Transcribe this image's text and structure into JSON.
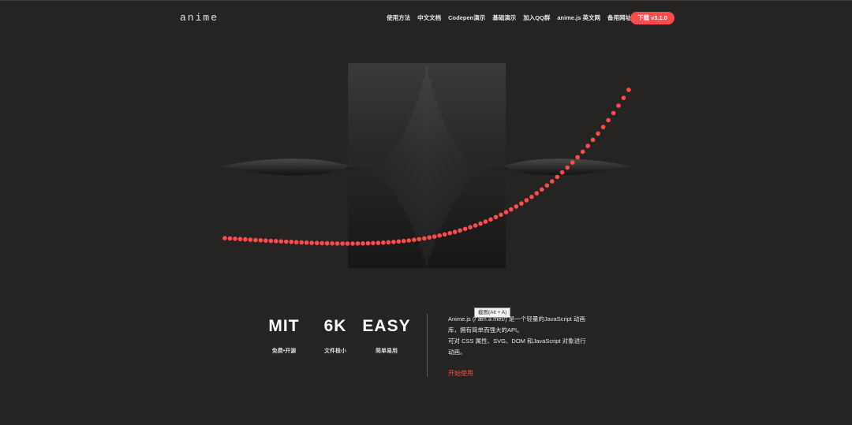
{
  "header": {
    "logo_text": "anime",
    "nav": [
      "使用方法",
      "中文文档",
      "Codepen演示",
      "基础演示",
      "加入QQ群",
      "anime.js 英文网",
      "备用网址"
    ],
    "download_label": "下载 v3.1.0"
  },
  "tooltip": "截图(Alt + A)",
  "stats": [
    {
      "value": "MIT",
      "label": "免费•开源"
    },
    {
      "value": "6K",
      "label": "文件极小"
    },
    {
      "value": "EASY",
      "label": "简单易用"
    }
  ],
  "description": {
    "line1": "Anime.js (/ˈæn.ə.meɪ/) 是一个轻量的JavaScript 动画库，拥有简单而强大的API。",
    "line2": "可对 CSS 属性、SVG、DOM 和JavaScript 对象进行动画。"
  },
  "start_label": "开始使用",
  "colors": {
    "background": "#252423",
    "accent": "#ff4b4b"
  }
}
